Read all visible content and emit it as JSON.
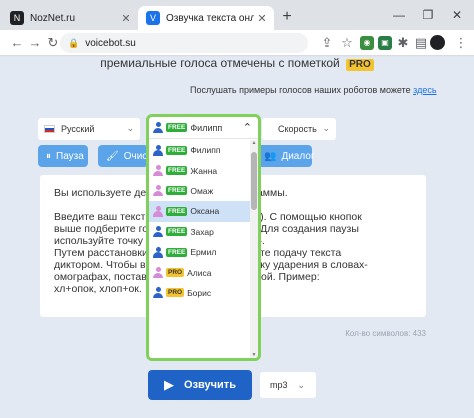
{
  "browser": {
    "tabs": [
      {
        "title": "NozNet.ru",
        "favicon": "N"
      },
      {
        "title": "Озвучка текста онлайн, синтез",
        "favicon": "V"
      }
    ],
    "url": "voicebot.su"
  },
  "page": {
    "premium_text": "премиальные голоса отмечены с пометкой",
    "premium_badge": "PRO",
    "samples_text": "Послушать примеры голосов наших роботов можете",
    "samples_link": "здесь",
    "language": "Русский",
    "speed": "Скорость",
    "pause_label": "Пауза",
    "clear_label": "Очист",
    "dialog_label": "Диалог",
    "text_p1": "Вы используете де                         ю программы.",
    "text_p2a": "Введите ваш текст                           мволов). С помощью кнопок",
    "text_p2b": "выше подберите го                           писка. Для создания паузы",
    "text_p2c": "используйте точку                            нак «.-».",
    "text_p3a": "Путем расстановки                           астройте подачу текста",
    "text_p3b": "диктором. Чтобы в                            становку ударения в словах-",
    "text_p3c": "омографах, постав                           й гласной. Пример:",
    "text_p3d": "хл+опок, хлоп+ок.",
    "counter": "Кол-во символов: 433",
    "speak_label": "Озвучить",
    "format": "mp3"
  },
  "voice_dropdown": {
    "selected": "Филипп",
    "selected_tag": "FREE",
    "items": [
      {
        "name": "Филипп",
        "tag": "FREE",
        "gender": "male"
      },
      {
        "name": "Жанна",
        "tag": "FREE",
        "gender": "female"
      },
      {
        "name": "Омаж",
        "tag": "FREE",
        "gender": "female"
      },
      {
        "name": "Оксана",
        "tag": "FREE",
        "gender": "female"
      },
      {
        "name": "Захар",
        "tag": "FREE",
        "gender": "male"
      },
      {
        "name": "Ермил",
        "tag": "FREE",
        "gender": "male"
      },
      {
        "name": "Алиса",
        "tag": "PRO",
        "gender": "female"
      },
      {
        "name": "Борис",
        "tag": "PRO",
        "gender": "male"
      }
    ],
    "highlighted_index": 3,
    "highlight_color": "#7fd15b"
  },
  "colors": {
    "accent_blue": "#5ba4e9",
    "speak_button": "#1f63c6",
    "free_tag": "#2fae3a",
    "pro_tag": "#f4c430"
  }
}
